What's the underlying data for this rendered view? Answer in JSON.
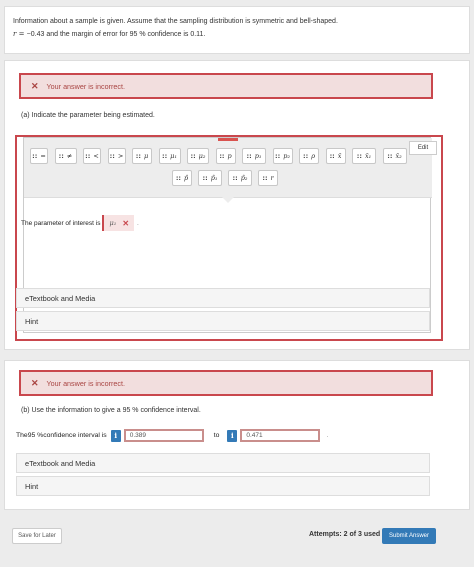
{
  "question": {
    "line1": "Information about a sample is given. Assume that the sampling distribution is symmetric and bell-shaped.",
    "r_label": "r = ",
    "r_value": "−0.43",
    "mid": " and the margin of error for ",
    "conf": "95 %",
    "end": " confidence is ",
    "moe": "0.11",
    "period": "."
  },
  "part_a": {
    "error_text": "Your answer is incorrect.",
    "label": "(a) Indicate the parameter being estimated.",
    "palette": {
      "row1": [
        {
          "hh": "::",
          "sym": "="
        },
        {
          "hh": "::",
          "sym": "≠"
        },
        {
          "hh": "::",
          "sym": "<"
        },
        {
          "hh": "::",
          "sym": ">"
        },
        {
          "hh": "::",
          "sym": "μ"
        },
        {
          "hh": "::",
          "sym": "μ₁"
        },
        {
          "hh": "::",
          "sym": "μ₂"
        },
        {
          "hh": "::",
          "sym": "p"
        },
        {
          "hh": "::",
          "sym": "p₁"
        },
        {
          "hh": "::",
          "sym": "p₂"
        },
        {
          "hh": "::",
          "sym": "ρ"
        },
        {
          "hh": "::",
          "sym": "x̄"
        },
        {
          "hh": "::",
          "sym": "x̄₁"
        },
        {
          "hh": "::",
          "sym": "x̄₂"
        }
      ],
      "row2": [
        {
          "hh": "::",
          "sym": "p̂"
        },
        {
          "hh": "::",
          "sym": "p̂₁"
        },
        {
          "hh": "::",
          "sym": "p̂₂"
        },
        {
          "hh": "::",
          "sym": "r"
        }
      ]
    },
    "edit_label": "Edit",
    "param_prefix": "The parameter of interest is",
    "param_answer": "μ₁",
    "param_suffix": "."
  },
  "resources_a": {
    "etextbook": "eTextbook and Media",
    "hint": "Hint"
  },
  "part_b": {
    "error_text": "Your answer is incorrect.",
    "label_pre": "(b) Use the information to give a ",
    "label_conf": "95 %",
    "label_post": " confidence interval.",
    "ci_pre": "The ",
    "ci_conf": "95 %",
    "ci_post": " confidence interval is",
    "lower": "0.389",
    "to": "to",
    "upper": "0.471",
    "period": "."
  },
  "resources_b": {
    "etextbook": "eTextbook and Media",
    "hint": "Hint"
  },
  "footer": {
    "save": "Save for Later",
    "attempts": "Attempts: 2 of 3 used",
    "submit": "Submit Answer"
  },
  "icons": {
    "info": "i",
    "error": "✕",
    "wrong": "✕"
  },
  "colors": {
    "error_border": "#c9474d",
    "error_bg": "#f2dede",
    "primary": "#337ab7"
  }
}
